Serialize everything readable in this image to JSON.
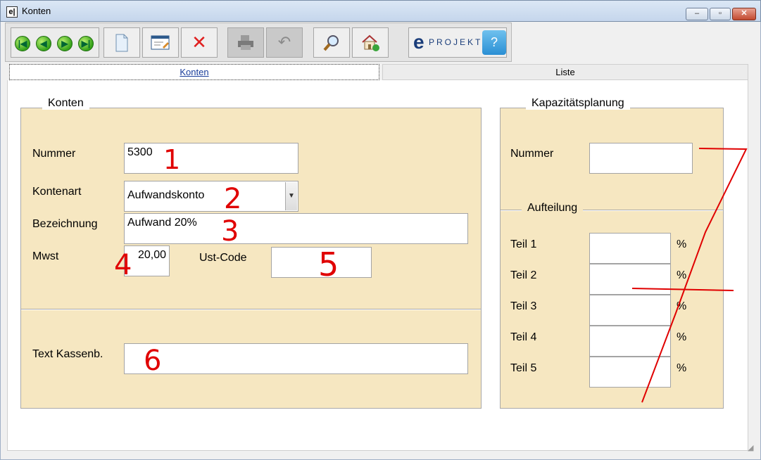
{
  "window": {
    "title": "Konten",
    "app_icon": "e|",
    "controls": {
      "minimize": "–",
      "maximize": "▫",
      "close": "✕"
    }
  },
  "toolbar": {
    "nav": [
      "first-record-icon",
      "prev-record-icon",
      "next-record-icon",
      "last-record-icon"
    ],
    "buttons": [
      "new-document-icon",
      "edit-form-icon",
      "delete-icon",
      "print-icon",
      "undo-icon",
      "search-icon",
      "home-icon"
    ],
    "eprojekt": {
      "e": "e",
      "text": "PROJEKT:"
    }
  },
  "tabs": {
    "konten": "Konten",
    "liste": "Liste"
  },
  "konten_panel": {
    "title": "Konten",
    "nummer_label": "Nummer",
    "nummer_value": "5300",
    "kontenart_label": "Kontenart",
    "kontenart_value": "Aufwandskonto",
    "bezeichnung_label": "Bezeichnung",
    "bezeichnung_value": "Aufwand 20%",
    "mwst_label": "Mwst",
    "mwst_value": "20,00",
    "ustcode_label": "Ust-Code",
    "ustcode_value": "",
    "textkassenb_label": "Text Kassenb.",
    "textkassenb_value": ""
  },
  "kapazitaet_panel": {
    "title": "Kapazitätsplanung",
    "nummer_label": "Nummer",
    "nummer_value": "",
    "aufteilung_title": "Aufteilung",
    "teile": [
      {
        "label": "Teil 1",
        "unit": "%"
      },
      {
        "label": "Teil 2",
        "unit": "%"
      },
      {
        "label": "Teil 3",
        "unit": "%"
      },
      {
        "label": "Teil 4",
        "unit": "%"
      },
      {
        "label": "Teil 5",
        "unit": "%"
      }
    ]
  },
  "annotations": {
    "n1": "1",
    "n2": "2",
    "n3": "3",
    "n4": "4",
    "n5": "5",
    "n6": "6",
    "n7": "7",
    "color": "#e00000"
  }
}
